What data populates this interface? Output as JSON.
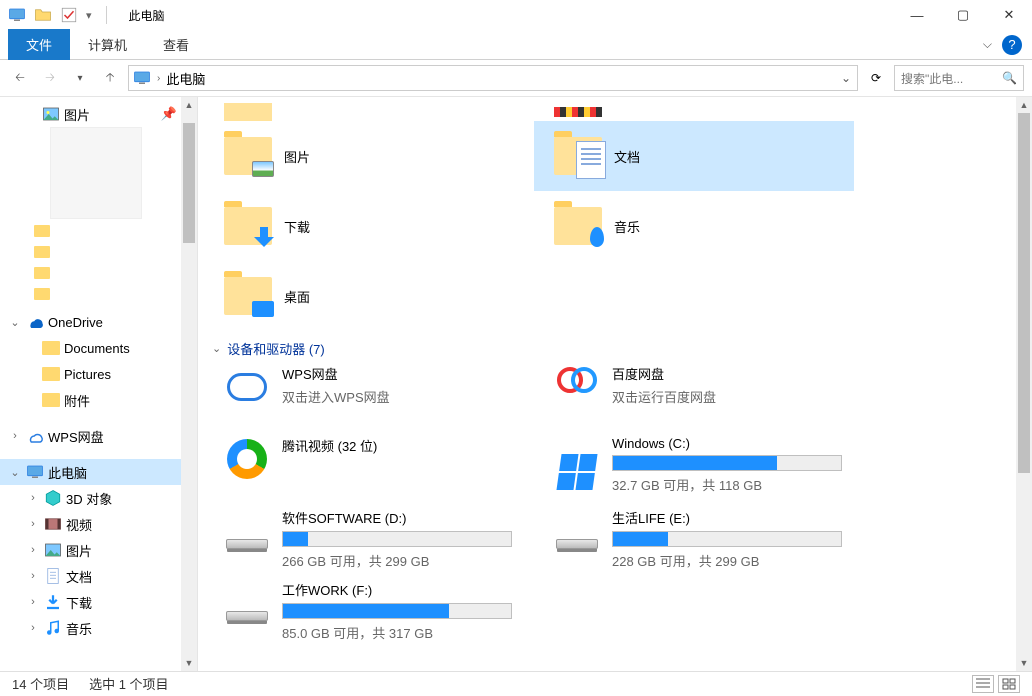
{
  "window": {
    "title": "此电脑",
    "sep": "|"
  },
  "ribbon": {
    "file": "文件",
    "computer": "计算机",
    "view": "查看"
  },
  "nav": {
    "crumbs": [
      "此电脑"
    ],
    "dropdown": "⌄"
  },
  "search": {
    "placeholder": "搜索\"此电..."
  },
  "sidebar": {
    "quick": {
      "pictures": "图片"
    },
    "onedrive": {
      "label": "OneDrive",
      "children": [
        "Documents",
        "Pictures",
        "附件"
      ]
    },
    "wps": {
      "label": "WPS网盘"
    },
    "thispc": {
      "label": "此电脑",
      "children": [
        "3D 对象",
        "视频",
        "图片",
        "文档",
        "下载",
        "音乐"
      ]
    }
  },
  "folders": {
    "pictures": "图片",
    "downloads": "下载",
    "desktop": "桌面",
    "documents": "文档",
    "music": "音乐"
  },
  "group": {
    "devices": "设备和驱动器 (7)"
  },
  "drives": {
    "wps": {
      "name": "WPS网盘",
      "sub": "双击进入WPS网盘"
    },
    "baidu": {
      "name": "百度网盘",
      "sub": "双击运行百度网盘"
    },
    "tencent": {
      "name": "腾讯视频 (32 位)"
    },
    "c": {
      "name": "Windows (C:)",
      "sub": "32.7 GB 可用，共 118 GB",
      "pct": 72
    },
    "d": {
      "name": "软件SOFTWARE (D:)",
      "sub": "266 GB 可用，共 299 GB",
      "pct": 11
    },
    "e": {
      "name": "生活LIFE (E:)",
      "sub": "228 GB 可用，共 299 GB",
      "pct": 24
    },
    "f": {
      "name": "工作WORK (F:)",
      "sub": "85.0 GB 可用，共 317 GB",
      "pct": 73
    }
  },
  "status": {
    "items": "14 个项目",
    "selected": "选中 1 个项目"
  }
}
